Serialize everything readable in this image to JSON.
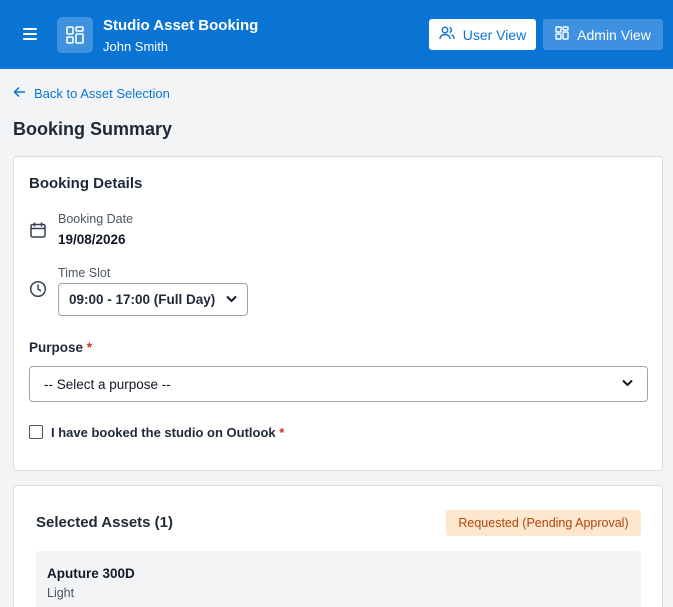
{
  "header": {
    "app_title": "Studio Asset Booking",
    "user_name": "John Smith",
    "user_view_label": "User View",
    "admin_view_label": "Admin View",
    "brand_color": "#0a74d4"
  },
  "navigation": {
    "back_label": "Back to Asset Selection"
  },
  "page": {
    "title": "Booking Summary"
  },
  "booking_details": {
    "title": "Booking Details",
    "date_label": "Booking Date",
    "date_value": "19/08/2026",
    "time_label": "Time Slot",
    "time_value": "09:00 - 17:00 (Full Day)",
    "purpose_label": "Purpose",
    "required_marker": "*",
    "purpose_placeholder": "-- Select a purpose --",
    "outlook_label": "I have booked the studio on Outlook",
    "outlook_checked": false
  },
  "selected_assets": {
    "title": "Selected Assets (1)",
    "status": "Requested (Pending Approval)",
    "items": [
      {
        "name": "Aputure 300D",
        "type": "Light"
      }
    ]
  }
}
